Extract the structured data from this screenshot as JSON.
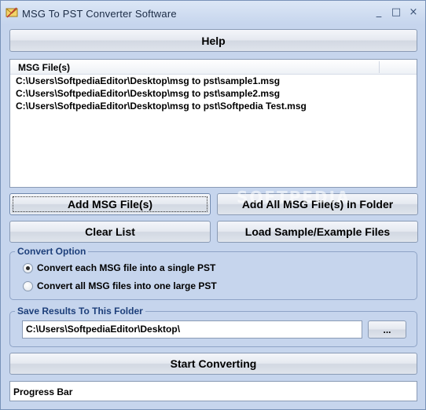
{
  "window": {
    "title": "MSG To PST Converter Software"
  },
  "titlebar_buttons": {
    "minimize": "_",
    "maximize": "□",
    "close": "×"
  },
  "buttons": {
    "help": "Help",
    "add_msg": "Add MSG File(s)",
    "add_all": "Add All MSG File(s) In Folder",
    "clear": "Clear List",
    "load_sample": "Load Sample/Example Files",
    "browse": "...",
    "start": "Start Converting"
  },
  "file_list": {
    "header": "MSG File(s)",
    "items": [
      "C:\\Users\\SoftpediaEditor\\Desktop\\msg to pst\\sample1.msg",
      "C:\\Users\\SoftpediaEditor\\Desktop\\msg to pst\\sample2.msg",
      "C:\\Users\\SoftpediaEditor\\Desktop\\msg to pst\\Softpedia Test.msg"
    ]
  },
  "convert_option": {
    "title": "Convert Option",
    "options": [
      {
        "label": "Convert each MSG file into a single PST",
        "checked": true
      },
      {
        "label": "Convert all MSG files into one large PST",
        "checked": false
      }
    ]
  },
  "save_results": {
    "title": "Save Results To This Folder",
    "path": "C:\\Users\\SoftpediaEditor\\Desktop\\"
  },
  "progress": {
    "label": "Progress Bar"
  },
  "watermark": "SOFTPEDIA"
}
